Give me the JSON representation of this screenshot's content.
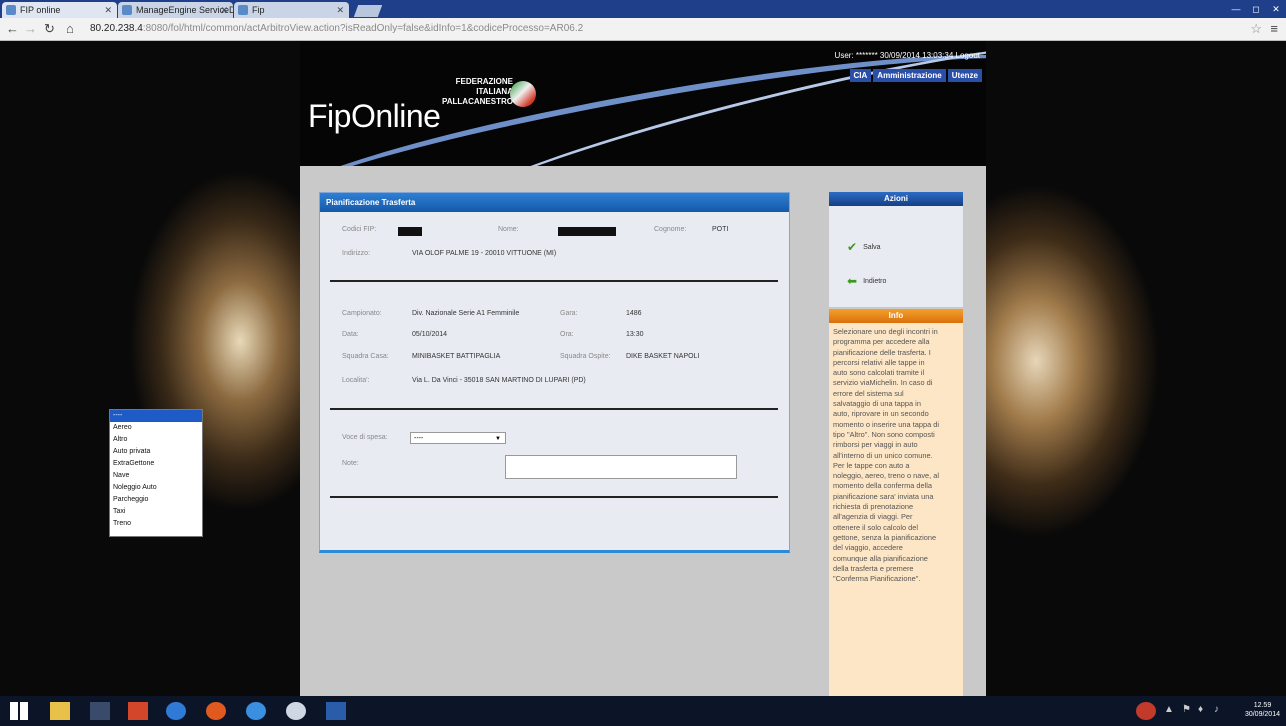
{
  "browser": {
    "tabs": [
      {
        "label": "FIP online"
      },
      {
        "label": "ManageEngine ServiceDe"
      },
      {
        "label": "Fip"
      }
    ],
    "url_host": "80.20.238.4",
    "url_rest": ":8080/fol/html/common/actArbitroView.action?isReadOnly=false&idInfo=1&codiceProcesso=AR06.2"
  },
  "header": {
    "logo": "FipOnline",
    "federation": [
      "FEDERAZIONE",
      "ITALIANA",
      "PALLACANESTRO"
    ],
    "user_line": "User: ******* 30/09/2014 13:03:34  Logout",
    "nav": [
      "CIA",
      "Amministrazione",
      "Utenze"
    ]
  },
  "panel": {
    "title": "Pianificazione Trasferta",
    "codici_label": "Codici FIP:",
    "nome_label": "Nome:",
    "cognome_label": "Cognome:",
    "cognome_value": "POTI",
    "indirizzo_label": "Indirizzo:",
    "indirizzo_value": "VIA OLOF PALME 19 - 20010 VITTUONE (MI)",
    "campionato_label": "Campionato:",
    "campionato_value": "Div. Nazionale Serie A1 Femminile",
    "gara_label": "Gara:",
    "gara_value": "1486",
    "data_label": "Data:",
    "data_value": "05/10/2014",
    "ora_label": "Ora:",
    "ora_value": "13:30",
    "casa_label": "Squadra Casa:",
    "casa_value": "MINIBASKET BATTIPAGLIA",
    "ospite_label": "Squadra Ospite:",
    "ospite_value": "DIKE BASKET NAPOLI",
    "localita_label": "Localita':",
    "localita_value": "Via L. Da Vinci - 35018 SAN MARTINO DI LUPARI (PD)",
    "voce_label": "Voce di spesa:",
    "voce_value": "----",
    "note_label": "Note:",
    "options": [
      "----",
      "Aereo",
      "Altro",
      "Auto privata",
      "ExtraGettone",
      "Nave",
      "Noleggio Auto",
      "Parcheggio",
      "Taxi",
      "Treno"
    ]
  },
  "azioni": {
    "title": "Azioni",
    "salva": "Salva",
    "indietro": "Indietro"
  },
  "info": {
    "title": "Info",
    "text": "Selezionare uno degli incontri in programma per accedere alla pianificazione delle trasferta. I percorsi relativi alle tappe in auto sono calcolati tramite il servizio viaMichelin. In caso di errore del sistema sul salvataggio di una tappa in auto, riprovare in un secondo momento o inserire una tappa di tipo \"Altro\". Non sono composti rimborsi per viaggi in auto all'interno di un unico comune. Per le tappe con auto a noleggio, aereo, treno o nave, al momento della conferma della pianificazione sara' inviata una richiesta di prenotazione all'agenzia di viaggi. Per ottenere il solo calcolo del gettone, senza la pianificazione del viaggio, accedere comunque alla pianificazione della trasferta e premere \"Conferma Pianificazione\"."
  },
  "taskbar": {
    "time": "12.59",
    "date": "30/09/2014"
  }
}
